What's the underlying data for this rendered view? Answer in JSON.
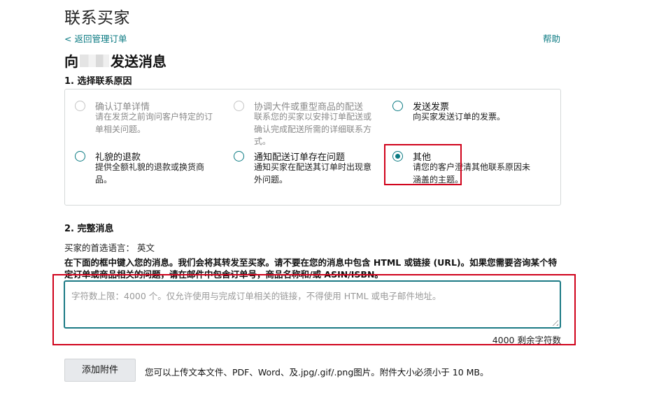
{
  "header": {
    "title": "联系买家",
    "back_link": "< 返回管理订单",
    "help_link": "帮助",
    "subtitle_prefix": "向",
    "subtitle_suffix": "发送消息"
  },
  "section1": {
    "title": "1. 选择联系原因",
    "options": [
      {
        "title": "确认订单详情",
        "desc": "请在发货之前询问客户特定的订单相关问题。",
        "state": "disabled"
      },
      {
        "title": "协调大件或重型商品的配送",
        "desc": "联系您的买家以安排订单配送或确认完成配送所需的详细联系方式。",
        "state": "disabled"
      },
      {
        "title": "发送发票",
        "desc": "向买家发送订单的发票。",
        "state": "enabled"
      },
      {
        "title": "礼貌的退款",
        "desc": "提供全额礼貌的退款或换货商品。",
        "state": "enabled"
      },
      {
        "title": "通知配送订单存在问题",
        "desc": "通知买家在配送其订单时出现意外问题。",
        "state": "enabled"
      },
      {
        "title": "其他",
        "desc": "请您的客户澄清其他联系原因未涵盖的主题。",
        "state": "checked"
      }
    ]
  },
  "section2": {
    "title": "2. 完整消息",
    "language_label": "买家的首选语言： 英文",
    "instruction": "在下面的框中键入您的消息。我们会将其转发至买家。请不要在您的消息中包含 HTML 或链接 (URL)。如果您需要咨询某个特定订单或商品相关的问题，请在邮件中包含订单号，商品名称和/或 ASIN/ISBN。",
    "message_placeholder": "字符数上限：4000 个。仅允许使用与完成订单相关的链接，不得使用 HTML 或电子邮件地址。",
    "counter": "4000 剩余字符数"
  },
  "attachment": {
    "button_label": "添加附件",
    "note": "您可以上传文本文件、PDF、Word、及.jpg/.gif/.png图片。附件大小必须小于 10 MB。"
  },
  "colors": {
    "accent": "#0a7a82",
    "highlight": "#d0021b"
  }
}
